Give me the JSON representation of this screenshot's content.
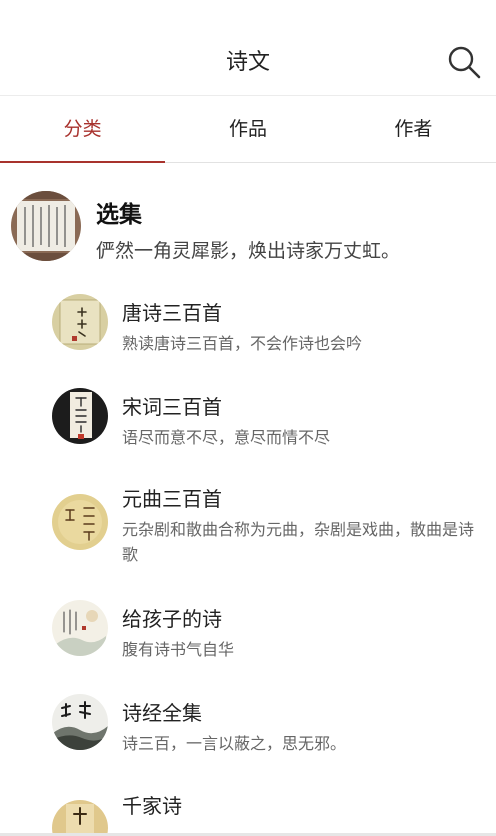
{
  "header": {
    "title": "诗文"
  },
  "tabs": [
    {
      "label": "分类",
      "active": true
    },
    {
      "label": "作品",
      "active": false
    },
    {
      "label": "作者",
      "active": false
    }
  ],
  "section": {
    "title": "选集",
    "description": "俨然一角灵犀影，焕出诗家万丈虹。"
  },
  "items": [
    {
      "title": "唐诗三百首",
      "description": "熟读唐诗三百首，不会作诗也会吟",
      "cover_icon": "tang-poems-cover-icon"
    },
    {
      "title": "宋词三百首",
      "description": "语尽而意不尽，意尽而情不尽",
      "cover_icon": "song-ci-cover-icon"
    },
    {
      "title": "元曲三百首",
      "description": "元杂剧和散曲合称为元曲，杂剧是戏曲，散曲是诗歌",
      "cover_icon": "yuan-qu-cover-icon"
    },
    {
      "title": "给孩子的诗",
      "description": "腹有诗书气自华",
      "cover_icon": "children-poems-cover-icon"
    },
    {
      "title": "诗经全集",
      "description": "诗三百，一言以蔽之，思无邪。",
      "cover_icon": "shijing-cover-icon"
    },
    {
      "title": "千家诗",
      "description": "",
      "cover_icon": "qianjia-cover-icon"
    }
  ],
  "colors": {
    "accent": "#a8322d",
    "text_primary": "#222222",
    "text_secondary": "#666666",
    "divider": "#e2e2e2"
  }
}
